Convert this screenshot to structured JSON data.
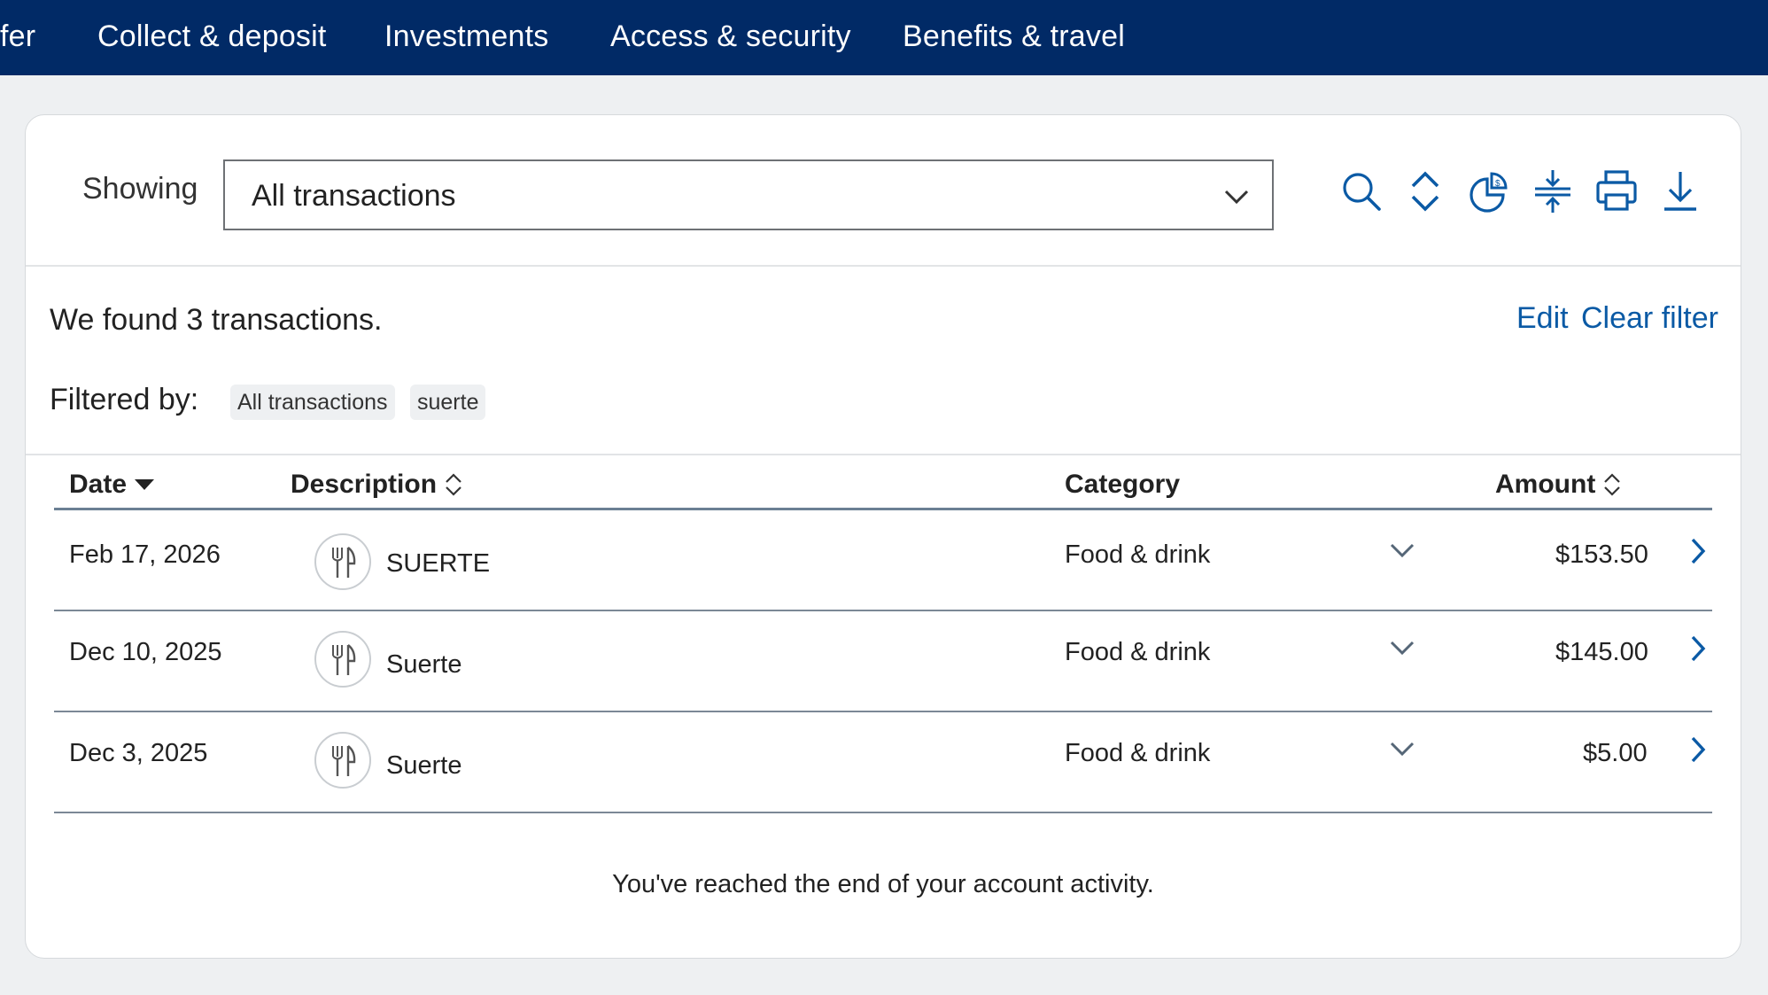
{
  "nav": {
    "items": [
      "fer",
      "Collect & deposit",
      "Investments",
      "Access & security",
      "Benefits & travel"
    ]
  },
  "filter": {
    "showing_label": "Showing",
    "selected": "All transactions"
  },
  "toolbar": {
    "icons": [
      "search-icon",
      "sort-icon",
      "spending-chart-icon",
      "collapse-icon",
      "print-icon",
      "download-icon"
    ],
    "accent": "#0b5aa5"
  },
  "results": {
    "summary": "We found 3 transactions.",
    "edit_label": "Edit",
    "clear_label": "Clear filter",
    "filtered_label": "Filtered by:",
    "chips": [
      "All transactions",
      "suerte"
    ]
  },
  "table": {
    "headers": {
      "date": "Date",
      "description": "Description",
      "category": "Category",
      "amount": "Amount"
    },
    "rows": [
      {
        "date": "Feb 17, 2026",
        "description": "SUERTE",
        "category": "Food & drink",
        "amount": "$153.50"
      },
      {
        "date": "Dec 10, 2025",
        "description": "Suerte",
        "category": "Food & drink",
        "amount": "$145.00"
      },
      {
        "date": "Dec 3, 2025",
        "description": "Suerte",
        "category": "Food & drink",
        "amount": "$5.00"
      }
    ],
    "end_message": "You've reached the end of your account activity."
  },
  "colors": {
    "nav_bg": "#012a66",
    "link": "#0b5aa5",
    "page_bg": "#eef0f2"
  }
}
